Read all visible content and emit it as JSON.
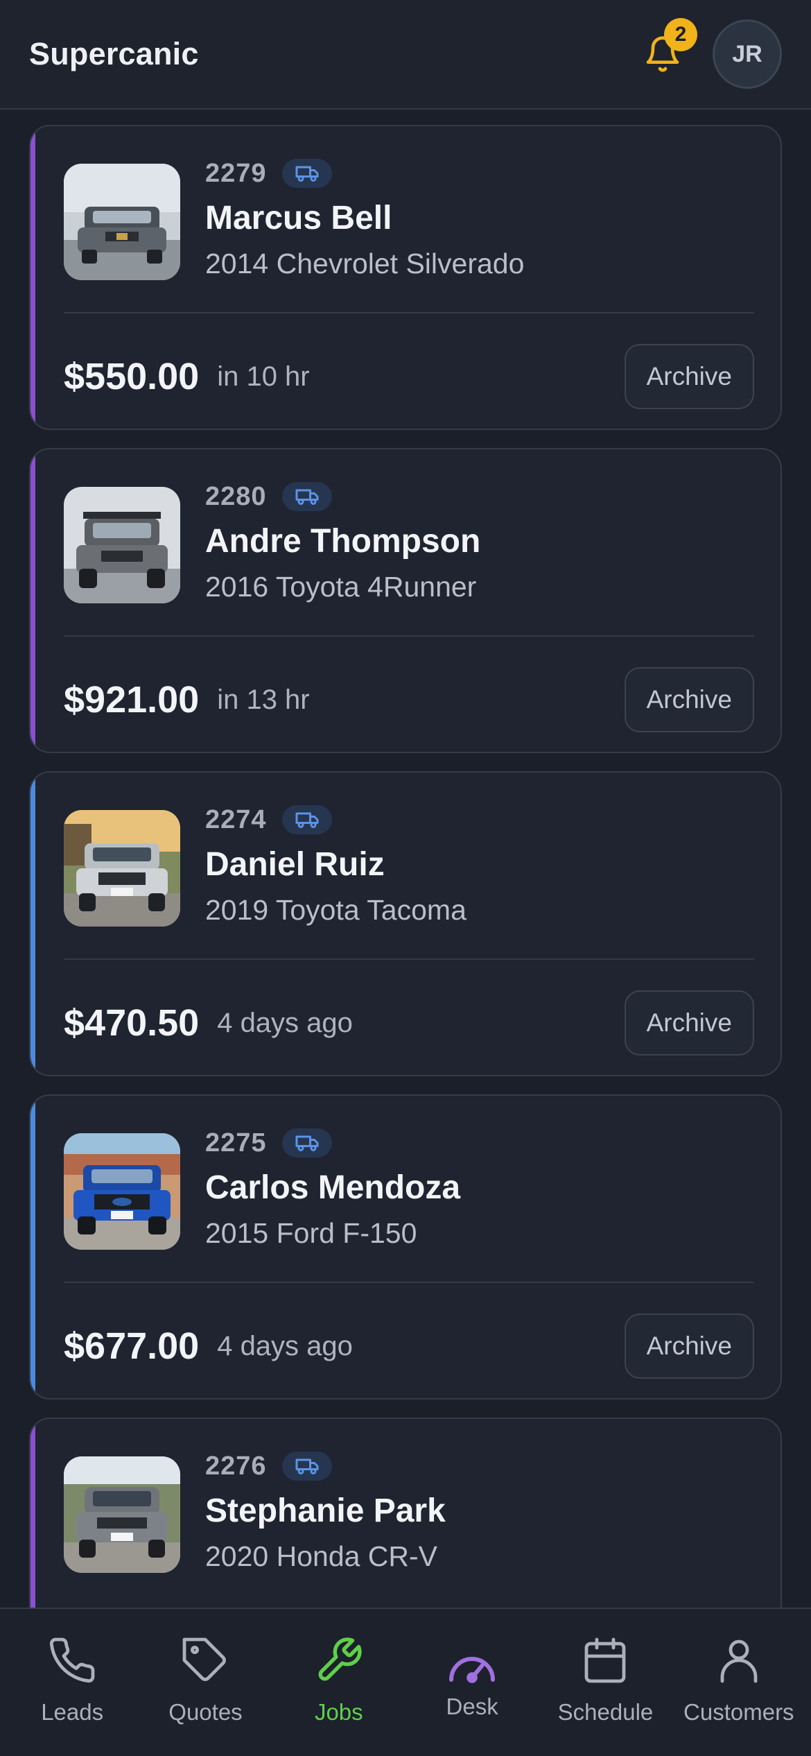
{
  "app": {
    "title": "Supercanic"
  },
  "header": {
    "notification_count": "2",
    "avatar_initials": "JR",
    "colors": {
      "bell": "#f2b21a",
      "badge": "#f2b21a"
    }
  },
  "jobs": [
    {
      "id": "2279",
      "customer": "Marcus Bell",
      "vehicle": "2014 Chevrolet Silverado",
      "price": "$550.00",
      "when": "in 10 hr",
      "archive_label": "Archive",
      "accent": "#8b4fd1",
      "type_icon": "van-icon"
    },
    {
      "id": "2280",
      "customer": "Andre Thompson",
      "vehicle": "2016 Toyota 4Runner",
      "price": "$921.00",
      "when": "in 13 hr",
      "archive_label": "Archive",
      "accent": "#8b4fd1",
      "type_icon": "van-icon"
    },
    {
      "id": "2274",
      "customer": "Daniel Ruiz",
      "vehicle": "2019 Toyota Tacoma",
      "price": "$470.50",
      "when": "4 days ago",
      "archive_label": "Archive",
      "accent": "#4a8be0",
      "type_icon": "van-icon"
    },
    {
      "id": "2275",
      "customer": "Carlos Mendoza",
      "vehicle": "2015 Ford F-150",
      "price": "$677.00",
      "when": "4 days ago",
      "archive_label": "Archive",
      "accent": "#4a8be0",
      "type_icon": "van-icon"
    },
    {
      "id": "2276",
      "customer": "Stephanie Park",
      "vehicle": "2020 Honda CR-V",
      "price": "",
      "when": "",
      "archive_label": "",
      "accent": "#8b4fd1",
      "type_icon": "van-icon"
    }
  ],
  "bottom_nav": [
    {
      "label": "Leads",
      "icon": "phone-icon",
      "active": false
    },
    {
      "label": "Quotes",
      "icon": "tag-icon",
      "active": false
    },
    {
      "label": "Jobs",
      "icon": "wrench-icon",
      "active": true
    },
    {
      "label": "Desk",
      "icon": "gauge-icon",
      "active": false
    },
    {
      "label": "Schedule",
      "icon": "calendar-icon",
      "active": false
    },
    {
      "label": "Customers",
      "icon": "person-icon",
      "active": false
    }
  ],
  "colors": {
    "active_nav": "#5fcf4a",
    "desk_icon": "#a070e0",
    "background": "#1a1f29"
  }
}
